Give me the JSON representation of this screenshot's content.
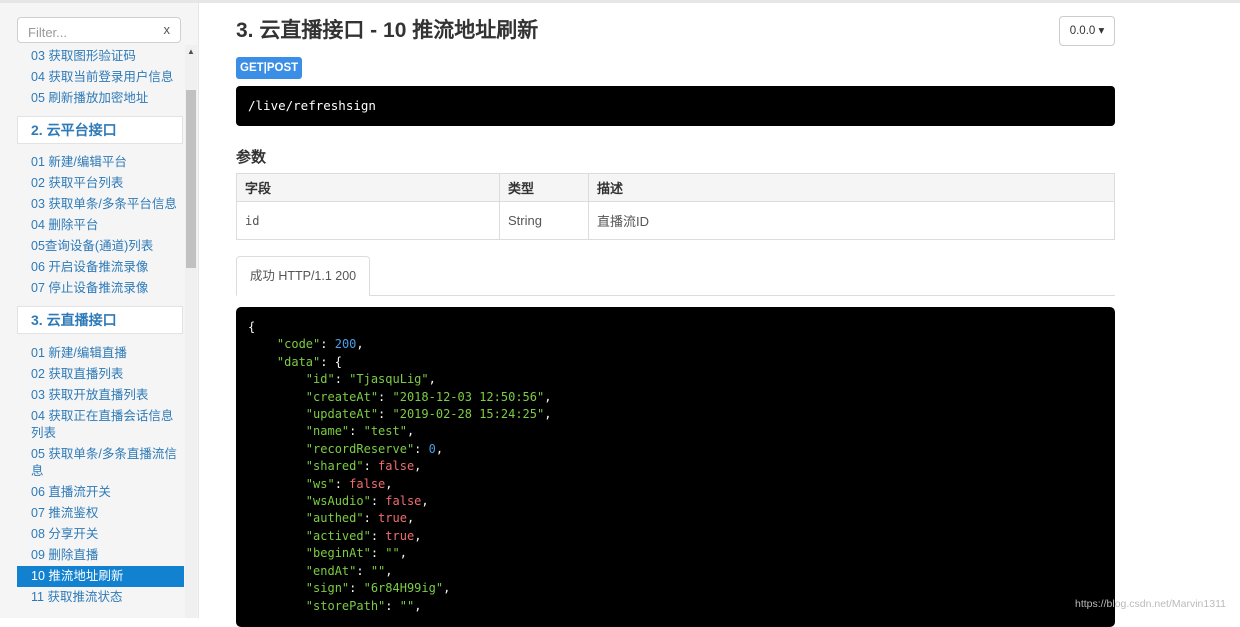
{
  "sidebar": {
    "filter_placeholder": "Filter...",
    "filter_clear": "x",
    "items_top": [
      {
        "label": "03 获取图形验证码"
      },
      {
        "label": "04 获取当前登录用户信息"
      },
      {
        "label": "05 刷新播放加密地址"
      }
    ],
    "group2": {
      "label": "2. 云平台接口"
    },
    "items_group2": [
      {
        "label": "01 新建/编辑平台"
      },
      {
        "label": "02 获取平台列表"
      },
      {
        "label": "03 获取单条/多条平台信息"
      },
      {
        "label": "04 删除平台"
      },
      {
        "label": "05查询设备(通道)列表"
      },
      {
        "label": "06 开启设备推流录像"
      },
      {
        "label": "07 停止设备推流录像"
      }
    ],
    "group3": {
      "label": "3. 云直播接口"
    },
    "items_group3": [
      {
        "label": "01 新建/编辑直播"
      },
      {
        "label": "02 获取直播列表"
      },
      {
        "label": "03 获取开放直播列表"
      },
      {
        "label": "04 获取正在直播会话信息列表"
      },
      {
        "label": "05 获取单条/多条直播流信息"
      },
      {
        "label": "06 直播流开关"
      },
      {
        "label": "07 推流鉴权"
      },
      {
        "label": "08 分享开关"
      },
      {
        "label": "09 删除直播"
      },
      {
        "label": "10 推流地址刷新",
        "active": true
      },
      {
        "label": "11 获取推流状态"
      }
    ]
  },
  "main": {
    "title": "3. 云直播接口 - 10 推流地址刷新",
    "version": "0.0.0 ▾",
    "method": "GET|POST",
    "url": "/live/refreshsign",
    "params_title": "参数",
    "params_table": {
      "headers": [
        "字段",
        "类型",
        "描述"
      ],
      "rows": [
        [
          "id",
          "String",
          "直播流ID"
        ]
      ]
    },
    "tab_label": "成功 HTTP/1.1 200"
  },
  "response": {
    "open_brace": "{",
    "code_key": "\"code\"",
    "code_val": "200",
    "data_key": "\"data\"",
    "fields": [
      {
        "key": "\"id\"",
        "val": "\"TjasquLig\"",
        "type": "s"
      },
      {
        "key": "\"createAt\"",
        "val": "\"2018-12-03 12:50:56\"",
        "type": "s"
      },
      {
        "key": "\"updateAt\"",
        "val": "\"2019-02-28 15:24:25\"",
        "type": "s"
      },
      {
        "key": "\"name\"",
        "val": "\"test\"",
        "type": "s"
      },
      {
        "key": "\"recordReserve\"",
        "val": "0",
        "type": "n"
      },
      {
        "key": "\"shared\"",
        "val": "false",
        "type": "b"
      },
      {
        "key": "\"ws\"",
        "val": "false",
        "type": "b"
      },
      {
        "key": "\"wsAudio\"",
        "val": "false",
        "type": "b"
      },
      {
        "key": "\"authed\"",
        "val": "true",
        "type": "b"
      },
      {
        "key": "\"actived\"",
        "val": "true",
        "type": "b"
      },
      {
        "key": "\"beginAt\"",
        "val": "\"\"",
        "type": "s"
      },
      {
        "key": "\"endAt\"",
        "val": "\"\"",
        "type": "s"
      },
      {
        "key": "\"sign\"",
        "val": "\"6r84H99ig\"",
        "type": "s"
      },
      {
        "key": "\"storePath\"",
        "val": "\"\"",
        "type": "s"
      }
    ]
  },
  "watermark": "https://blog.csdn.net/Marvin1311"
}
